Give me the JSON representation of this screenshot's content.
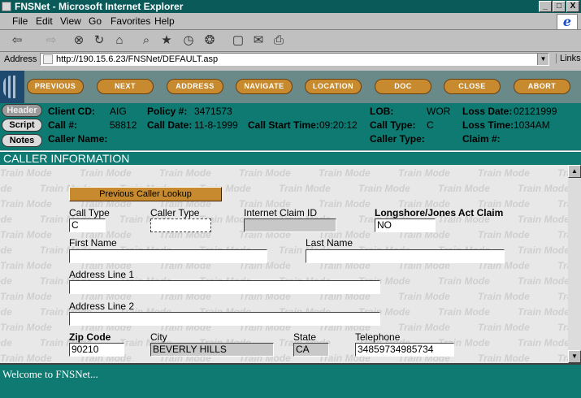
{
  "window": {
    "title": "FNSNet - Microsoft Internet Explorer",
    "btn_min": "_",
    "btn_max": "□",
    "btn_close": "X"
  },
  "menu": [
    "File",
    "Edit",
    "View",
    "Go",
    "Favorites",
    "Help"
  ],
  "toolbar": {
    "back": "⇦",
    "forward": "⇨",
    "stop": "⊗",
    "refresh": "↻",
    "home": "⌂",
    "search": "⌕",
    "favorites": "★",
    "history": "◷",
    "channels": "❂",
    "fullscreen": "▢",
    "mail": "✉",
    "print": "⎙"
  },
  "address": {
    "label": "Address",
    "url": "http://190.15.6.23/FNSNet/DEFAULT.asp",
    "links": "Links"
  },
  "nav_buttons": [
    "PREVIOUS",
    "NEXT",
    "ADDRESS",
    "NAVIGATE",
    "LOCATION",
    "DOC",
    "CLOSE",
    "ABORT"
  ],
  "side_buttons": [
    "Header",
    "Script",
    "Notes"
  ],
  "info": {
    "client_cd_label": "Client CD:",
    "client_cd": "AIG",
    "policy_label": "Policy #:",
    "policy": "3471573",
    "lob_label": "LOB:",
    "lob": "WOR",
    "loss_date_label": "Loss Date:",
    "loss_date": "02121999",
    "call_label": "Call #:",
    "call": "58812",
    "call_date_label": "Call Date:",
    "call_date": "11-8-1999",
    "call_start_label": "Call Start Time:",
    "call_start": "09:20:12",
    "call_type_label": "Call Type:",
    "call_type": "C",
    "loss_time_label": "Loss Time:",
    "loss_time": "1034AM",
    "caller_name_label": "Caller Name:",
    "caller_type_label": "Caller Type:",
    "claim_label": "Claim #:"
  },
  "section_title": "CALLER INFORMATION",
  "watermark": "Train Mode",
  "form": {
    "lookup_button": "Previous Caller Lookup",
    "call_type_label": "Call Type",
    "call_type_value": "C",
    "caller_type_label": "Caller Type",
    "caller_type_value": "",
    "internet_claim_label": "Internet Claim ID",
    "internet_claim_value": "",
    "longshore_label": "Longshore/Jones Act Claim",
    "longshore_value": "NO",
    "first_name_label": "First Name",
    "first_name_value": "",
    "last_name_label": "Last Name",
    "last_name_value": "",
    "address1_label": "Address Line 1",
    "address1_value": "",
    "address2_label": "Address Line 2",
    "address2_value": "",
    "zip_label": "Zip Code",
    "zip_value": "90210",
    "city_label": "City",
    "city_value": "BEVERLY HILLS",
    "state_label": "State",
    "state_value": "CA",
    "telephone_label": "Telephone",
    "telephone_value": "34859734985734"
  },
  "status": {
    "text": "Welcome to FNSNet..."
  }
}
